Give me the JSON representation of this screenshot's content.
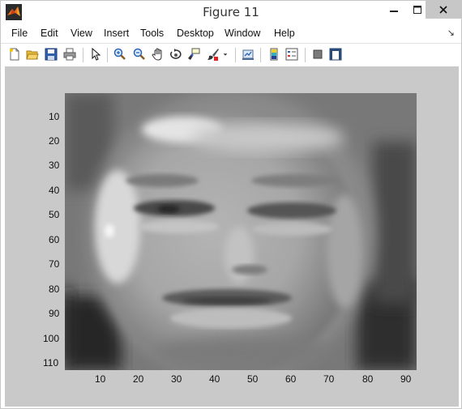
{
  "window": {
    "title": "Figure 11"
  },
  "menu": [
    "File",
    "Edit",
    "View",
    "Insert",
    "Tools",
    "Desktop",
    "Window",
    "Help"
  ],
  "toolbar": {
    "icons": [
      "new-figure-icon",
      "open-file-icon",
      "save-icon",
      "print-icon",
      "edit-plot-arrow-icon",
      "zoom-in-icon",
      "zoom-out-icon",
      "pan-hand-icon",
      "rotate-3d-icon",
      "data-cursor-icon",
      "brush-icon",
      "brush-dropdown-icon",
      "link-plot-icon",
      "insert-colorbar-icon",
      "insert-legend-icon",
      "hide-plot-tools-icon",
      "show-plot-tools-icon"
    ]
  },
  "axes": {
    "y_ticks": [
      "10",
      "20",
      "30",
      "40",
      "50",
      "60",
      "70",
      "80",
      "90",
      "100",
      "110"
    ],
    "x_ticks": [
      "10",
      "20",
      "30",
      "40",
      "50",
      "60",
      "70",
      "80",
      "90"
    ]
  },
  "chart_data": {
    "type": "heatmap",
    "colormap": "gray",
    "xlim": [
      0.5,
      92.5
    ],
    "ylim": [
      0.5,
      112.5
    ],
    "y_reversed": true,
    "x_ticks": [
      10,
      20,
      30,
      40,
      50,
      60,
      70,
      80,
      90
    ],
    "y_ticks": [
      10,
      20,
      30,
      40,
      50,
      60,
      70,
      80,
      90,
      100,
      110
    ],
    "image_size": [
      112,
      92
    ],
    "content": "grayscale average face image"
  },
  "colors": {
    "canvas": "#c9c9c9",
    "close_button": "#c7c7c7"
  }
}
